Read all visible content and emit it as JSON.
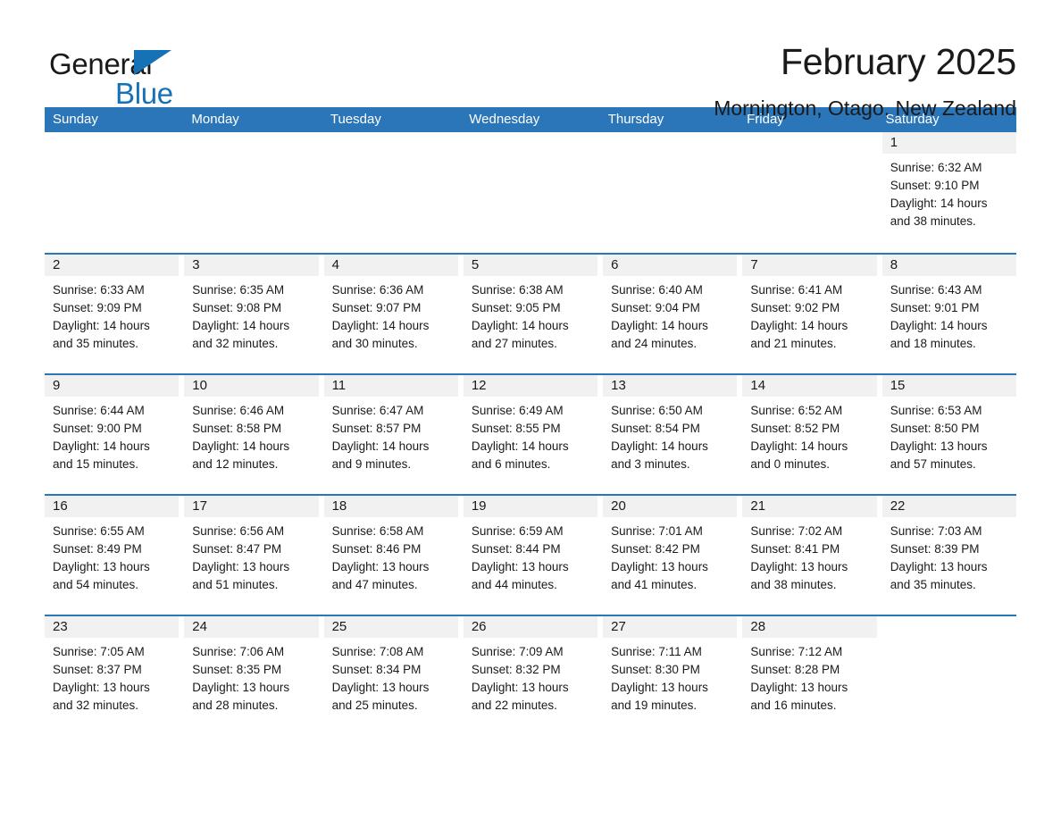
{
  "logo": {
    "line1": "General",
    "line2": "Blue",
    "triangle_color": "#1572b6"
  },
  "header": {
    "title": "February 2025",
    "subtitle": "Mornington, Otago, New Zealand"
  },
  "theme": {
    "header_blue": "#2b76b9",
    "daynum_gray": "#f1f1f1",
    "text": "#1a1a1a"
  },
  "weekdays": [
    "Sunday",
    "Monday",
    "Tuesday",
    "Wednesday",
    "Thursday",
    "Friday",
    "Saturday"
  ],
  "weeks": [
    [
      {
        "day": "",
        "blank": true
      },
      {
        "day": "",
        "blank": true
      },
      {
        "day": "",
        "blank": true
      },
      {
        "day": "",
        "blank": true
      },
      {
        "day": "",
        "blank": true
      },
      {
        "day": "",
        "blank": true
      },
      {
        "day": "1",
        "sunrise": "Sunrise: 6:32 AM",
        "sunset": "Sunset: 9:10 PM",
        "daylight1": "Daylight: 14 hours",
        "daylight2": "and 38 minutes."
      }
    ],
    [
      {
        "day": "2",
        "sunrise": "Sunrise: 6:33 AM",
        "sunset": "Sunset: 9:09 PM",
        "daylight1": "Daylight: 14 hours",
        "daylight2": "and 35 minutes."
      },
      {
        "day": "3",
        "sunrise": "Sunrise: 6:35 AM",
        "sunset": "Sunset: 9:08 PM",
        "daylight1": "Daylight: 14 hours",
        "daylight2": "and 32 minutes."
      },
      {
        "day": "4",
        "sunrise": "Sunrise: 6:36 AM",
        "sunset": "Sunset: 9:07 PM",
        "daylight1": "Daylight: 14 hours",
        "daylight2": "and 30 minutes."
      },
      {
        "day": "5",
        "sunrise": "Sunrise: 6:38 AM",
        "sunset": "Sunset: 9:05 PM",
        "daylight1": "Daylight: 14 hours",
        "daylight2": "and 27 minutes."
      },
      {
        "day": "6",
        "sunrise": "Sunrise: 6:40 AM",
        "sunset": "Sunset: 9:04 PM",
        "daylight1": "Daylight: 14 hours",
        "daylight2": "and 24 minutes."
      },
      {
        "day": "7",
        "sunrise": "Sunrise: 6:41 AM",
        "sunset": "Sunset: 9:02 PM",
        "daylight1": "Daylight: 14 hours",
        "daylight2": "and 21 minutes."
      },
      {
        "day": "8",
        "sunrise": "Sunrise: 6:43 AM",
        "sunset": "Sunset: 9:01 PM",
        "daylight1": "Daylight: 14 hours",
        "daylight2": "and 18 minutes."
      }
    ],
    [
      {
        "day": "9",
        "sunrise": "Sunrise: 6:44 AM",
        "sunset": "Sunset: 9:00 PM",
        "daylight1": "Daylight: 14 hours",
        "daylight2": "and 15 minutes."
      },
      {
        "day": "10",
        "sunrise": "Sunrise: 6:46 AM",
        "sunset": "Sunset: 8:58 PM",
        "daylight1": "Daylight: 14 hours",
        "daylight2": "and 12 minutes."
      },
      {
        "day": "11",
        "sunrise": "Sunrise: 6:47 AM",
        "sunset": "Sunset: 8:57 PM",
        "daylight1": "Daylight: 14 hours",
        "daylight2": "and 9 minutes."
      },
      {
        "day": "12",
        "sunrise": "Sunrise: 6:49 AM",
        "sunset": "Sunset: 8:55 PM",
        "daylight1": "Daylight: 14 hours",
        "daylight2": "and 6 minutes."
      },
      {
        "day": "13",
        "sunrise": "Sunrise: 6:50 AM",
        "sunset": "Sunset: 8:54 PM",
        "daylight1": "Daylight: 14 hours",
        "daylight2": "and 3 minutes."
      },
      {
        "day": "14",
        "sunrise": "Sunrise: 6:52 AM",
        "sunset": "Sunset: 8:52 PM",
        "daylight1": "Daylight: 14 hours",
        "daylight2": "and 0 minutes."
      },
      {
        "day": "15",
        "sunrise": "Sunrise: 6:53 AM",
        "sunset": "Sunset: 8:50 PM",
        "daylight1": "Daylight: 13 hours",
        "daylight2": "and 57 minutes."
      }
    ],
    [
      {
        "day": "16",
        "sunrise": "Sunrise: 6:55 AM",
        "sunset": "Sunset: 8:49 PM",
        "daylight1": "Daylight: 13 hours",
        "daylight2": "and 54 minutes."
      },
      {
        "day": "17",
        "sunrise": "Sunrise: 6:56 AM",
        "sunset": "Sunset: 8:47 PM",
        "daylight1": "Daylight: 13 hours",
        "daylight2": "and 51 minutes."
      },
      {
        "day": "18",
        "sunrise": "Sunrise: 6:58 AM",
        "sunset": "Sunset: 8:46 PM",
        "daylight1": "Daylight: 13 hours",
        "daylight2": "and 47 minutes."
      },
      {
        "day": "19",
        "sunrise": "Sunrise: 6:59 AM",
        "sunset": "Sunset: 8:44 PM",
        "daylight1": "Daylight: 13 hours",
        "daylight2": "and 44 minutes."
      },
      {
        "day": "20",
        "sunrise": "Sunrise: 7:01 AM",
        "sunset": "Sunset: 8:42 PM",
        "daylight1": "Daylight: 13 hours",
        "daylight2": "and 41 minutes."
      },
      {
        "day": "21",
        "sunrise": "Sunrise: 7:02 AM",
        "sunset": "Sunset: 8:41 PM",
        "daylight1": "Daylight: 13 hours",
        "daylight2": "and 38 minutes."
      },
      {
        "day": "22",
        "sunrise": "Sunrise: 7:03 AM",
        "sunset": "Sunset: 8:39 PM",
        "daylight1": "Daylight: 13 hours",
        "daylight2": "and 35 minutes."
      }
    ],
    [
      {
        "day": "23",
        "sunrise": "Sunrise: 7:05 AM",
        "sunset": "Sunset: 8:37 PM",
        "daylight1": "Daylight: 13 hours",
        "daylight2": "and 32 minutes."
      },
      {
        "day": "24",
        "sunrise": "Sunrise: 7:06 AM",
        "sunset": "Sunset: 8:35 PM",
        "daylight1": "Daylight: 13 hours",
        "daylight2": "and 28 minutes."
      },
      {
        "day": "25",
        "sunrise": "Sunrise: 7:08 AM",
        "sunset": "Sunset: 8:34 PM",
        "daylight1": "Daylight: 13 hours",
        "daylight2": "and 25 minutes."
      },
      {
        "day": "26",
        "sunrise": "Sunrise: 7:09 AM",
        "sunset": "Sunset: 8:32 PM",
        "daylight1": "Daylight: 13 hours",
        "daylight2": "and 22 minutes."
      },
      {
        "day": "27",
        "sunrise": "Sunrise: 7:11 AM",
        "sunset": "Sunset: 8:30 PM",
        "daylight1": "Daylight: 13 hours",
        "daylight2": "and 19 minutes."
      },
      {
        "day": "28",
        "sunrise": "Sunrise: 7:12 AM",
        "sunset": "Sunset: 8:28 PM",
        "daylight1": "Daylight: 13 hours",
        "daylight2": "and 16 minutes."
      },
      {
        "day": "",
        "blank": true
      }
    ]
  ]
}
